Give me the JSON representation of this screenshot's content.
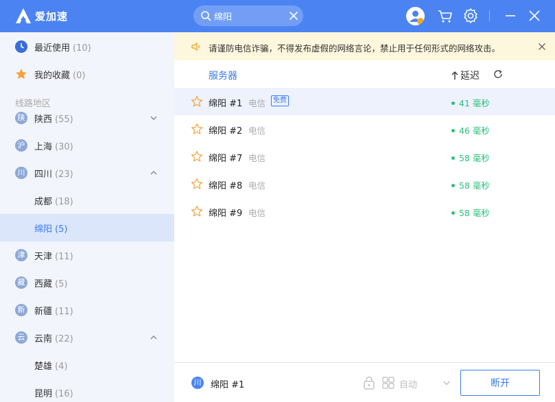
{
  "app": {
    "name": "爱加速",
    "brand_color": "#4b84f2"
  },
  "search": {
    "value": "绵阳"
  },
  "header": {
    "icons": [
      "search-icon",
      "clear-icon",
      "avatar",
      "cart-icon",
      "settings-icon",
      "minimize-icon",
      "close-icon"
    ]
  },
  "sidebar": {
    "recent": {
      "label": "最近使用",
      "count": "(10)"
    },
    "favorites": {
      "label": "我的收藏",
      "count": "(0)"
    },
    "section_title": "线路地区",
    "regions": [
      {
        "icon": "陕",
        "label": "陕西",
        "count": "(55)",
        "expanded": false
      },
      {
        "icon": "沪",
        "label": "上海",
        "count": "(30)"
      },
      {
        "icon": "川",
        "label": "四川",
        "count": "(23)",
        "expanded": true
      },
      {
        "label": "成都",
        "count": "(18)"
      },
      {
        "label": "绵阳",
        "count": "(5)",
        "selected": true
      },
      {
        "icon": "津",
        "label": "天津",
        "count": "(11)"
      },
      {
        "icon": "藏",
        "label": "西藏",
        "count": "(5)"
      },
      {
        "icon": "新",
        "label": "新疆",
        "count": "(11)"
      },
      {
        "icon": "云",
        "label": "云南",
        "count": "(22)",
        "expanded": true
      },
      {
        "label": "楚雄",
        "count": "(4)"
      },
      {
        "label": "昆明",
        "count": "(16)"
      }
    ]
  },
  "notice": {
    "text": "请谨防电信诈骗，不得发布虚假的网络言论，禁止用于任何形式的网络攻击。"
  },
  "list": {
    "col_server": "服务器",
    "col_latency": "延迟",
    "servers": [
      {
        "name": "绵阳 #1",
        "isp": "电信",
        "badge": "免费",
        "ping": "41 毫秒",
        "selected": true
      },
      {
        "name": "绵阳 #2",
        "isp": "电信",
        "ping": "46 毫秒"
      },
      {
        "name": "绵阳 #7",
        "isp": "电信",
        "ping": "58 毫秒"
      },
      {
        "name": "绵阳 #8",
        "isp": "电信",
        "ping": "58 毫秒"
      },
      {
        "name": "绵阳 #9",
        "isp": "电信",
        "ping": "58 毫秒"
      }
    ]
  },
  "footer": {
    "badge": "川",
    "current": "绵阳 #1",
    "mode": "自动",
    "disconnect": "断开"
  }
}
